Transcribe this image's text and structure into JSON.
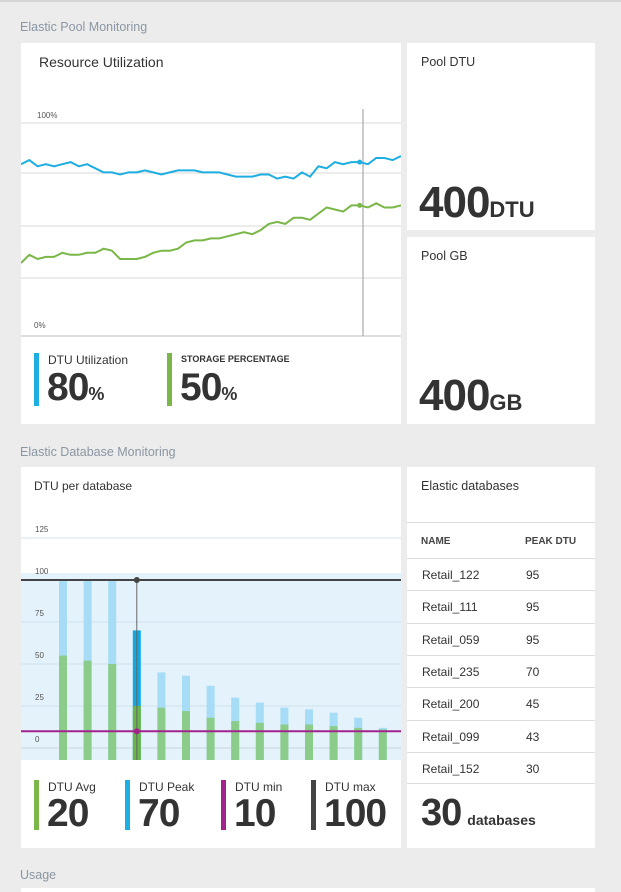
{
  "pool_section": {
    "label": "Elastic Pool Monitoring",
    "resource_tile": {
      "title": "Resource Utilization",
      "y_top_label": "100%",
      "y_bottom_label": "0%",
      "metrics": [
        {
          "label": "DTU Utilization",
          "value": "80",
          "unit": "%",
          "color": "#1eaee0"
        },
        {
          "label": "STORAGE PERCENTAGE",
          "value": "50",
          "unit": "%",
          "color": "#7ab648"
        }
      ]
    },
    "pool_dtu": {
      "title": "Pool DTU",
      "value": "400",
      "unit": "DTU"
    },
    "pool_gb": {
      "title": "Pool GB",
      "value": "400",
      "unit": "GB"
    }
  },
  "database_section": {
    "label": "Elastic Database Monitoring",
    "dtu_tile": {
      "title": "DTU per database",
      "metrics": [
        {
          "label": "DTU Avg",
          "value": "20",
          "color": "#7ab648"
        },
        {
          "label": "DTU Peak",
          "value": "70",
          "color": "#1eaee0"
        },
        {
          "label": "DTU min",
          "value": "10",
          "color": "#a3238e"
        },
        {
          "label": "DTU max",
          "value": "100",
          "color": "#444444"
        }
      ]
    },
    "databases_tile": {
      "title": "Elastic databases",
      "columns": [
        "NAME",
        "PEAK DTU"
      ],
      "rows": [
        {
          "name": "Retail_122",
          "peak": "95"
        },
        {
          "name": "Retail_111",
          "peak": "95"
        },
        {
          "name": "Retail_059",
          "peak": "95"
        },
        {
          "name": "Retail_235",
          "peak": "70"
        },
        {
          "name": "Retail_200",
          "peak": "45"
        },
        {
          "name": "Retail_099",
          "peak": "43"
        },
        {
          "name": "Retail_152",
          "peak": "30"
        }
      ],
      "total_value": "30",
      "total_unit": "databases"
    }
  },
  "usage_section": {
    "label": "Usage"
  },
  "chart_data": [
    {
      "type": "line",
      "ylim": [
        0,
        100
      ],
      "y_tick_labels": [
        "100%",
        "0%"
      ],
      "series": [
        {
          "name": "DTU Utilization",
          "color": "#1eaee0",
          "values": [
            80,
            82,
            79,
            80,
            79,
            80,
            81,
            79,
            80,
            78,
            76,
            76,
            75,
            76,
            76,
            77,
            76,
            75,
            76,
            77,
            77,
            77,
            76,
            76,
            76,
            75,
            74,
            74,
            74,
            75,
            75,
            73,
            74,
            73,
            76,
            74,
            79,
            78,
            81,
            80,
            81,
            81,
            80,
            83,
            83,
            82,
            84
          ]
        },
        {
          "name": "STORAGE PERCENTAGE",
          "color": "#7ab648",
          "values": [
            32,
            36,
            34,
            35,
            35,
            37,
            36,
            36,
            37,
            37,
            39,
            38,
            34,
            34,
            34,
            35,
            37,
            38,
            38,
            39,
            42,
            43,
            43,
            44,
            44,
            45,
            46,
            47,
            46,
            48,
            51,
            52,
            51,
            54,
            54,
            53,
            56,
            59,
            58,
            57,
            60,
            60,
            59,
            61,
            59,
            59,
            60
          ]
        }
      ]
    },
    {
      "type": "bar",
      "ylim": [
        0,
        125
      ],
      "y_ticks": [
        0,
        25,
        50,
        75,
        100,
        125
      ],
      "series": [
        {
          "name": "DTU Peak",
          "color": "#a6dcf5",
          "values": [
            100,
            100,
            100,
            70,
            45,
            43,
            37,
            30,
            27,
            24,
            23,
            21,
            18,
            12,
            10
          ]
        },
        {
          "name": "DTU Avg",
          "color": "#8ccc8a",
          "values": [
            55,
            52,
            50,
            25,
            24,
            22,
            18,
            16,
            15,
            14,
            14,
            13,
            12,
            11,
            10
          ]
        }
      ],
      "reference_lines": [
        {
          "name": "DTU max",
          "value": 100,
          "color": "#444444"
        },
        {
          "name": "DTU min",
          "value": 10,
          "color": "#a3238e"
        }
      ]
    }
  ]
}
